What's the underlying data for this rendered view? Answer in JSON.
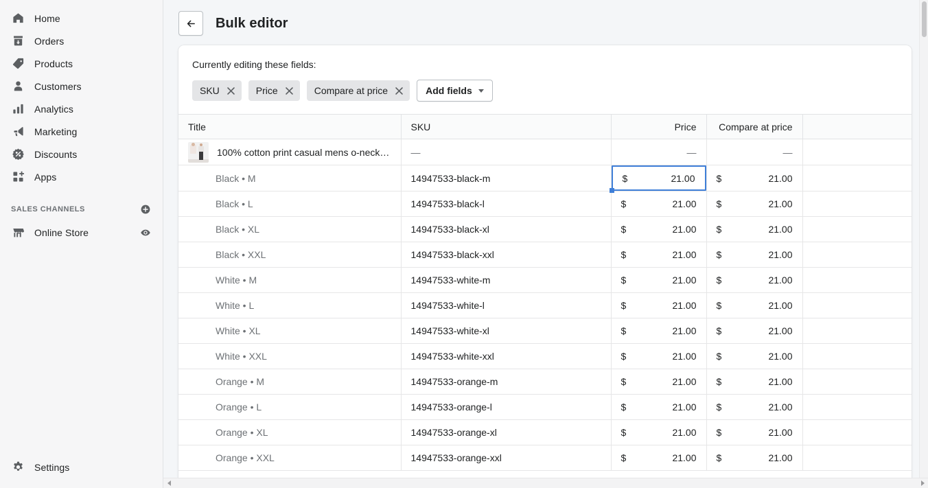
{
  "sidebar": {
    "items": [
      {
        "label": "Home",
        "icon": "home-icon"
      },
      {
        "label": "Orders",
        "icon": "orders-icon"
      },
      {
        "label": "Products",
        "icon": "products-tag-icon"
      },
      {
        "label": "Customers",
        "icon": "customers-person-icon"
      },
      {
        "label": "Analytics",
        "icon": "analytics-bars-icon"
      },
      {
        "label": "Marketing",
        "icon": "marketing-megaphone-icon"
      },
      {
        "label": "Discounts",
        "icon": "discounts-percent-icon"
      },
      {
        "label": "Apps",
        "icon": "apps-grid-plus-icon"
      }
    ],
    "section": {
      "title": "SALES CHANNELS",
      "add_icon": "circle-plus-icon",
      "channels": [
        {
          "label": "Online Store",
          "icon": "online-store-icon",
          "action_icon": "eye-icon"
        }
      ]
    },
    "footer": {
      "label": "Settings",
      "icon": "gear-icon"
    }
  },
  "header": {
    "back_icon": "arrow-left-icon",
    "title": "Bulk editor"
  },
  "fields": {
    "label": "Currently editing these fields:",
    "chips": [
      {
        "label": "SKU",
        "remove_icon": "close-icon"
      },
      {
        "label": "Price",
        "remove_icon": "close-icon"
      },
      {
        "label": "Compare at price",
        "remove_icon": "close-icon"
      }
    ],
    "add_button": {
      "label": "Add fields",
      "icon": "chevron-down-icon"
    }
  },
  "table": {
    "columns": [
      "Title",
      "SKU",
      "Price",
      "Compare at price",
      ""
    ],
    "empty_value": "—",
    "currency_symbol": "$",
    "product": {
      "title": "100% cotton print casual mens o-neck t...",
      "sku": "—",
      "price": "—",
      "compare_at_price": "—"
    },
    "variants": [
      {
        "name": "Black • M",
        "sku": "14947533-black-m",
        "price": "21.00",
        "compare_at_price": "21.00",
        "focused": true
      },
      {
        "name": "Black • L",
        "sku": "14947533-black-l",
        "price": "21.00",
        "compare_at_price": "21.00"
      },
      {
        "name": "Black • XL",
        "sku": "14947533-black-xl",
        "price": "21.00",
        "compare_at_price": "21.00"
      },
      {
        "name": "Black • XXL",
        "sku": "14947533-black-xxl",
        "price": "21.00",
        "compare_at_price": "21.00"
      },
      {
        "name": "White • M",
        "sku": "14947533-white-m",
        "price": "21.00",
        "compare_at_price": "21.00"
      },
      {
        "name": "White • L",
        "sku": "14947533-white-l",
        "price": "21.00",
        "compare_at_price": "21.00"
      },
      {
        "name": "White • XL",
        "sku": "14947533-white-xl",
        "price": "21.00",
        "compare_at_price": "21.00"
      },
      {
        "name": "White • XXL",
        "sku": "14947533-white-xxl",
        "price": "21.00",
        "compare_at_price": "21.00"
      },
      {
        "name": "Orange • M",
        "sku": "14947533-orange-m",
        "price": "21.00",
        "compare_at_price": "21.00"
      },
      {
        "name": "Orange • L",
        "sku": "14947533-orange-l",
        "price": "21.00",
        "compare_at_price": "21.00"
      },
      {
        "name": "Orange • XL",
        "sku": "14947533-orange-xl",
        "price": "21.00",
        "compare_at_price": "21.00"
      },
      {
        "name": "Orange • XXL",
        "sku": "14947533-orange-xxl",
        "price": "21.00",
        "compare_at_price": "21.00"
      }
    ]
  },
  "colors": {
    "accent_focus": "#3f7fd8",
    "sidebar_bg": "#f6f6f7",
    "page_bg": "#f4f6f8",
    "text": "#202223",
    "text_subdued": "#6d7175"
  }
}
